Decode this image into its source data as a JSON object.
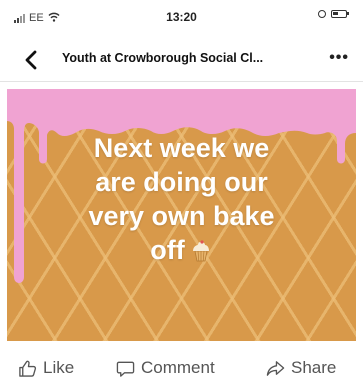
{
  "status_bar": {
    "carrier": "EE",
    "time": "13:20"
  },
  "header": {
    "title": "Youth at Crowborough Social Cl...",
    "back_icon": "chevron-left-icon",
    "more_label": "•••"
  },
  "post": {
    "lines": [
      "Next week we",
      "are doing our",
      "very own bake",
      "off"
    ],
    "emoji_icon": "cupcake-icon",
    "colors": {
      "background": "#d8994a",
      "icing": "#f0a3d2",
      "text": "#ffffff"
    }
  },
  "actions": {
    "like_label": "Like",
    "comment_label": "Comment",
    "share_label": "Share"
  }
}
